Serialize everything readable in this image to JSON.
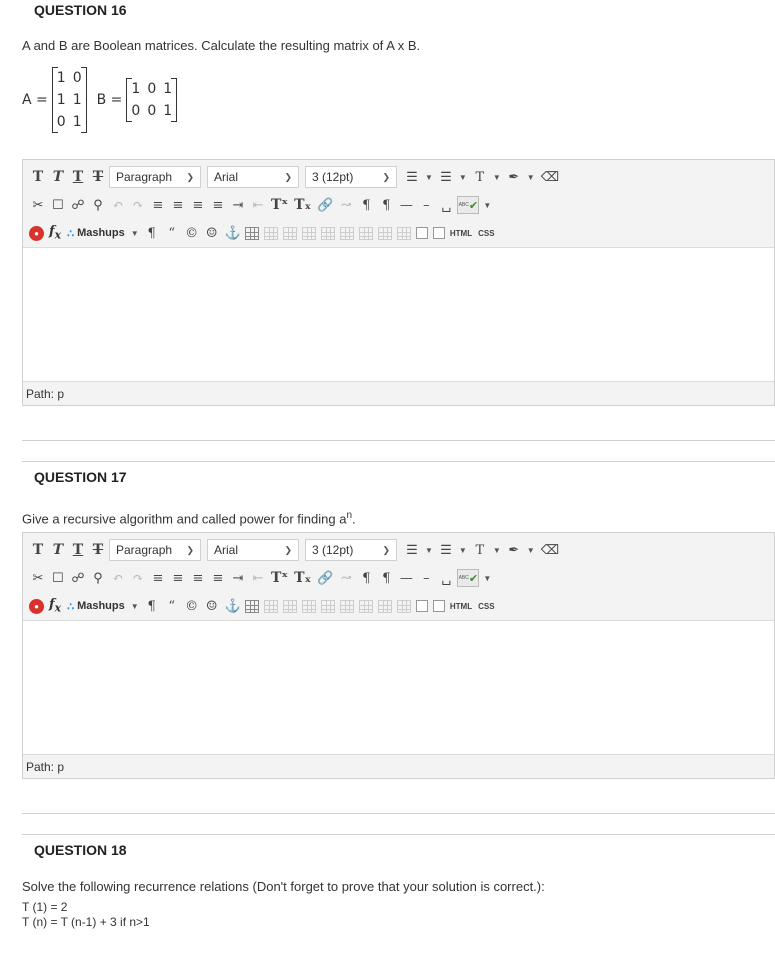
{
  "q16": {
    "title": "QUESTION 16",
    "text": "A and B are Boolean matrices.  Calculate the resulting matrix  of A x B.",
    "matrix_a_label": "A =",
    "matrix_a": [
      [
        "1",
        "0"
      ],
      [
        "1",
        "1"
      ],
      [
        "0",
        "1"
      ]
    ],
    "matrix_b_label": "B =",
    "matrix_b": [
      [
        "1",
        "0",
        "1"
      ],
      [
        "0",
        "0",
        "1"
      ]
    ]
  },
  "q17": {
    "title": "QUESTION 17",
    "text_before": "Give  a recursive algorithm and called power for finding a",
    "text_sup": "n",
    "text_after": "."
  },
  "q18": {
    "title": "QUESTION 18",
    "text": "Solve the following recurrence relations (Don't forget to prove that your solution is correct.):",
    "line1": "T (1) = 2",
    "line2": "T (n) = T (n-1) + 3   if  n>1"
  },
  "toolbar": {
    "format_buttons": [
      "T",
      "T",
      "T",
      "T"
    ],
    "paragraph": "Paragraph",
    "font": "Arial",
    "size": "3 (12pt)",
    "mashups": "Mashups",
    "html_label": "HTML",
    "css_label": "CSS",
    "spell_label": "ABC",
    "text_color": "T",
    "superscript": "Tˣ",
    "subscript": "Tₓ"
  },
  "editor": {
    "path_label": "Path: p"
  },
  "colors": {
    "toolbar_bg": "#f3f3f3",
    "border": "#cfcfcf",
    "mashups_accent": "#2f8fd8",
    "record_red": "#d9312b"
  }
}
